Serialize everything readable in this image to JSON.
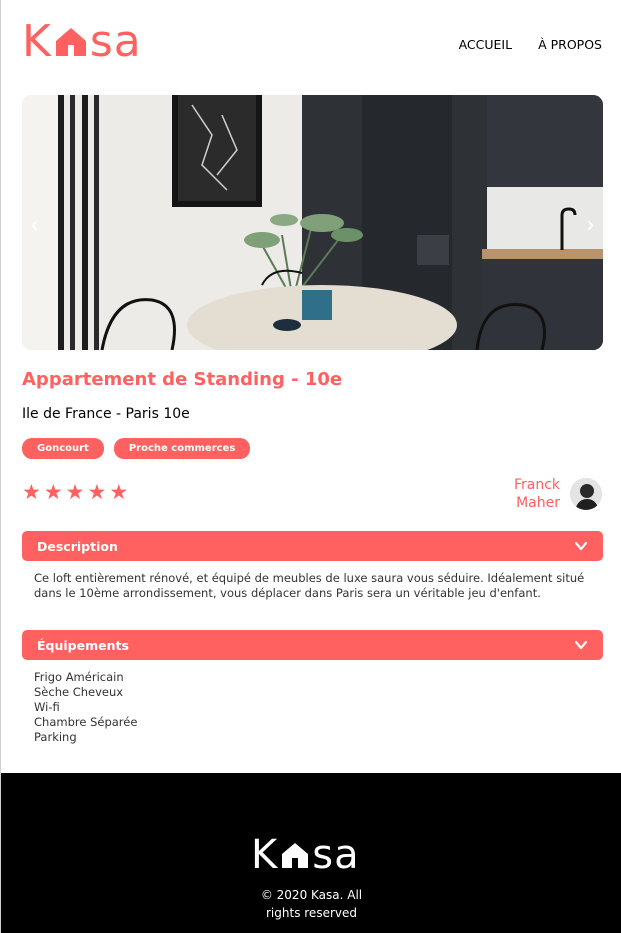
{
  "header": {
    "logo_letters": {
      "left": "K",
      "right": "sa"
    },
    "nav": [
      {
        "label": "ACCUEIL"
      },
      {
        "label": "À PROPOS"
      }
    ]
  },
  "gallery": {
    "prev_icon": "chevron-left-icon",
    "next_icon": "chevron-right-icon",
    "prev_glyph": "‹",
    "next_glyph": "›"
  },
  "listing": {
    "title": "Appartement de Standing - 10e",
    "location": "Ile de France - Paris 10e",
    "tags": [
      "Goncourt",
      "Proche commerces"
    ],
    "rating": {
      "value": 5,
      "max": 5
    },
    "host": {
      "first_name": "Franck",
      "last_name": "Maher"
    }
  },
  "description": {
    "header": "Description",
    "text": "Ce loft entièrement rénové, et équipé de meubles de luxe saura vous séduire. Idéalement situé dans le 10ème arrondissement, vous déplacer dans Paris sera un véritable jeu d'enfant."
  },
  "equipements": {
    "header": "Équipements",
    "items": [
      "Frigo Américain",
      "Sèche Cheveux",
      "Wi-fi",
      "Chambre Séparée",
      "Parking"
    ]
  },
  "footer": {
    "logo_letters": {
      "left": "K",
      "right": "sa"
    },
    "copyright_line1": "© 2020 Kasa. All",
    "copyright_line2": "rights reserved"
  },
  "colors": {
    "accent": "#ff6060",
    "footer_bg": "#000000",
    "text": "#000000"
  }
}
